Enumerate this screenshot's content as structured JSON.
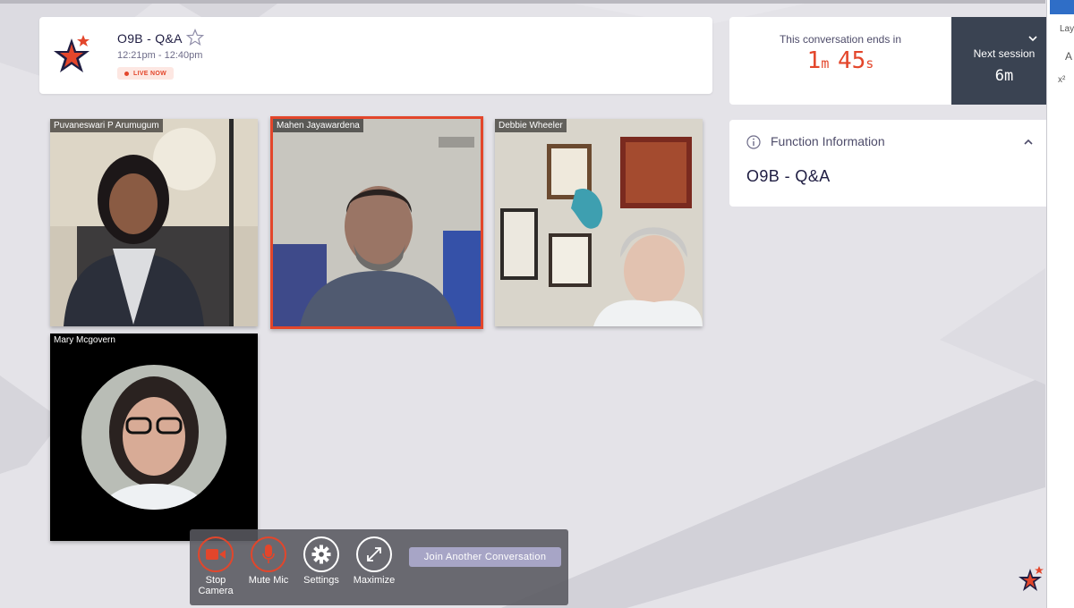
{
  "session": {
    "title": "O9B - Q&A",
    "time": "12:21pm - 12:40pm",
    "live_label": "LIVE NOW"
  },
  "timer": {
    "label": "This conversation ends in",
    "minutes": "1",
    "minutes_unit": "m",
    "seconds": "45",
    "seconds_unit": "s"
  },
  "next_session": {
    "label": "Next session",
    "value": "6m"
  },
  "function_info": {
    "title": "Function Information",
    "body": "O9B - Q&A"
  },
  "participants": [
    {
      "name": "Puvaneswari P Arumugum",
      "active": false
    },
    {
      "name": "Mahen Jayawardena",
      "active": true
    },
    {
      "name": "Debbie Wheeler",
      "active": false
    },
    {
      "name": "Mary Mcgovern",
      "active": false
    }
  ],
  "controls": {
    "stop_camera": "Stop Camera",
    "mute_mic": "Mute Mic",
    "settings": "Settings",
    "maximize": "Maximize",
    "join": "Join Another Conversation"
  },
  "side_panel": {
    "t1": "Lay",
    "t2": "A",
    "t3": "x²"
  },
  "colors": {
    "accent": "#e3462b",
    "navy": "#1f1d42",
    "next_bg": "#3a4352",
    "join_bg": "#a7a5c6"
  }
}
